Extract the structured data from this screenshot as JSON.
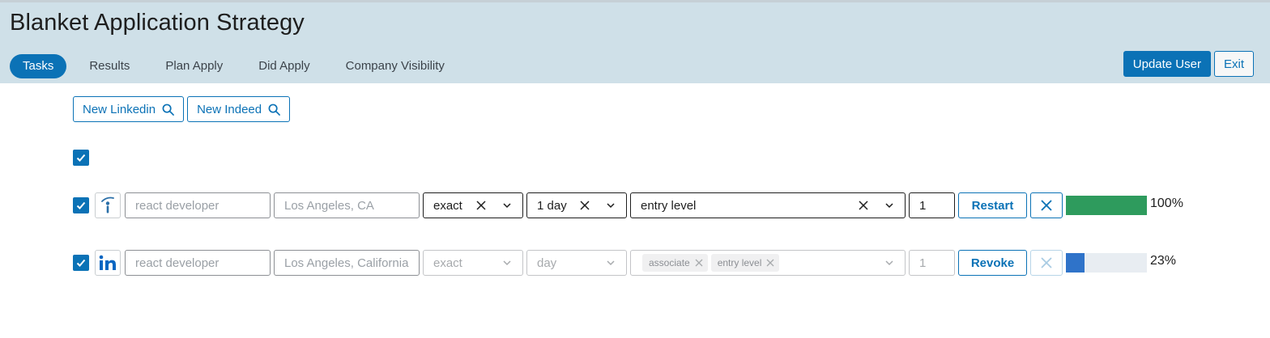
{
  "header": {
    "title": "Blanket Application Strategy",
    "tabs": [
      {
        "label": "Tasks",
        "active": true
      },
      {
        "label": "Results",
        "active": false
      },
      {
        "label": "Plan Apply",
        "active": false
      },
      {
        "label": "Did Apply",
        "active": false
      },
      {
        "label": "Company Visibility",
        "active": false
      }
    ],
    "update_user_label": "Update User",
    "exit_label": "Exit"
  },
  "toolbar": {
    "new_linkedin_label": "New Linkedin",
    "new_indeed_label": "New Indeed"
  },
  "select_all": {
    "checked": true
  },
  "rows": [
    {
      "source": "indeed-icon",
      "checked": true,
      "keywords_placeholder": "react developer",
      "location_placeholder": "Los Angeles, CA",
      "match": "exact",
      "date_posted": "1 day",
      "experience_levels": [
        "entry level"
      ],
      "count": "1",
      "action_label": "Restart",
      "progress": 1.0,
      "progress_text": "100%",
      "progress_color": "#2e9b5d"
    },
    {
      "source": "linkedin-icon",
      "checked": true,
      "keywords_placeholder": "react developer",
      "location_placeholder": "Los Angeles, California",
      "match": "exact",
      "date_posted": "day",
      "experience_levels": [
        "associate",
        "entry level"
      ],
      "count": "1",
      "action_label": "Revoke",
      "progress": 0.23,
      "progress_text": "23%",
      "progress_color": "#2f73c9"
    }
  ],
  "colors": {
    "accent": "#0b72b6",
    "header_bg": "#cfe0e8",
    "success": "#2e9b5d"
  }
}
